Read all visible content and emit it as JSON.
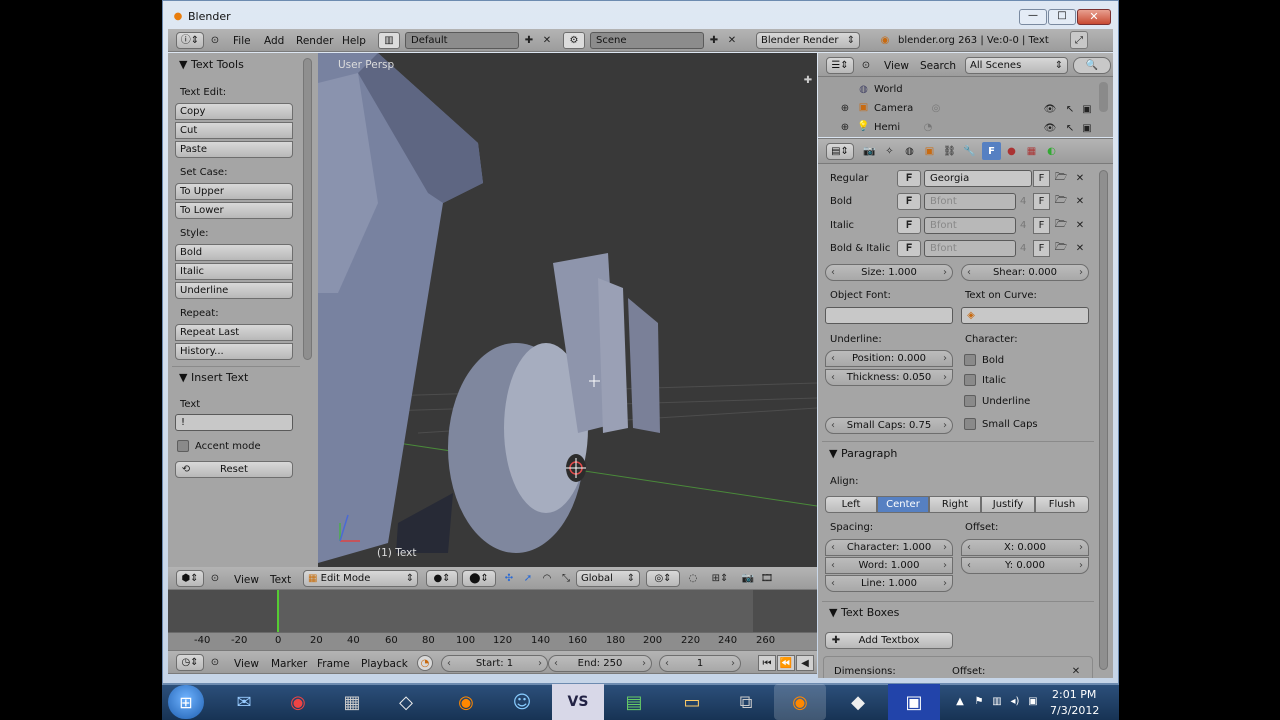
{
  "window": {
    "title": "Blender"
  },
  "info_header": {
    "menus": [
      "File",
      "Add",
      "Render",
      "Help"
    ],
    "layout": "Default",
    "scene": "Scene",
    "engine": "Blender Render",
    "stats": "blender.org 263 | Ve:0-0 | Text"
  },
  "tool_shelf": {
    "text_tools_title": "Text Tools",
    "text_edit_label": "Text Edit:",
    "copy": "Copy",
    "cut": "Cut",
    "paste": "Paste",
    "set_case_label": "Set Case:",
    "to_upper": "To Upper",
    "to_lower": "To Lower",
    "style_label": "Style:",
    "bold": "Bold",
    "italic": "Italic",
    "underline": "Underline",
    "repeat_label": "Repeat:",
    "repeat_last": "Repeat Last",
    "history": "History...",
    "insert_text_title": "Insert Text",
    "text_label": "Text",
    "text_value": "!",
    "accent_mode": "Accent mode",
    "reset": "Reset"
  },
  "viewport": {
    "view_name": "User Persp",
    "object_label": "(1) Text",
    "letters": "eng",
    "header": {
      "view": "View",
      "text": "Text",
      "mode": "Edit Mode",
      "orientation": "Global"
    }
  },
  "timeline": {
    "ticks": [
      "-40",
      "-20",
      "0",
      "20",
      "40",
      "60",
      "80",
      "100",
      "120",
      "140",
      "160",
      "180",
      "200",
      "220",
      "240",
      "260"
    ],
    "menus": [
      "View",
      "Marker",
      "Frame",
      "Playback"
    ],
    "start": "Start: 1",
    "end": "End: 250",
    "current": "1"
  },
  "outliner": {
    "menus": [
      "View",
      "Search"
    ],
    "filter": "All Scenes",
    "items": [
      "World",
      "Camera",
      "Hemi"
    ]
  },
  "properties": {
    "font": {
      "regular_label": "Regular",
      "regular_value": "Georgia",
      "bold_label": "Bold",
      "bold_value": "Bfont",
      "italic_label": "Italic",
      "italic_value": "Bfont",
      "bold_italic_label": "Bold & Italic",
      "bold_italic_value": "Bfont",
      "users": "4",
      "f_button": "F"
    },
    "size": "Size: 1.000",
    "shear": "Shear: 0.000",
    "object_font_label": "Object Font:",
    "text_on_curve_label": "Text on Curve:",
    "underline_label": "Underline:",
    "position": "Position: 0.000",
    "thickness": "Thickness: 0.050",
    "character_label": "Character:",
    "char_bold": "Bold",
    "char_italic": "Italic",
    "char_underline": "Underline",
    "char_small_caps": "Small Caps",
    "small_caps": "Small Caps: 0.75",
    "paragraph_title": "Paragraph",
    "align_label": "Align:",
    "align": [
      "Left",
      "Center",
      "Right",
      "Justify",
      "Flush"
    ],
    "spacing_label": "Spacing:",
    "character_spacing": "Character: 1.000",
    "word_spacing": "Word: 1.000",
    "line_spacing": "Line: 1.000",
    "offset_label": "Offset:",
    "offset_x": "X: 0.000",
    "offset_y": "Y: 0.000",
    "text_boxes_title": "Text Boxes",
    "add_textbox": "Add Textbox",
    "dimensions_label": "Dimensions:",
    "offset2_label": "Offset:"
  },
  "taskbar": {
    "time": "2:01 PM",
    "date": "7/3/2012"
  },
  "colors": {
    "accent": "#5680c2",
    "panel": "#a5a5a5",
    "viewport": "#393939",
    "taskbar": "#1c3a5e"
  }
}
